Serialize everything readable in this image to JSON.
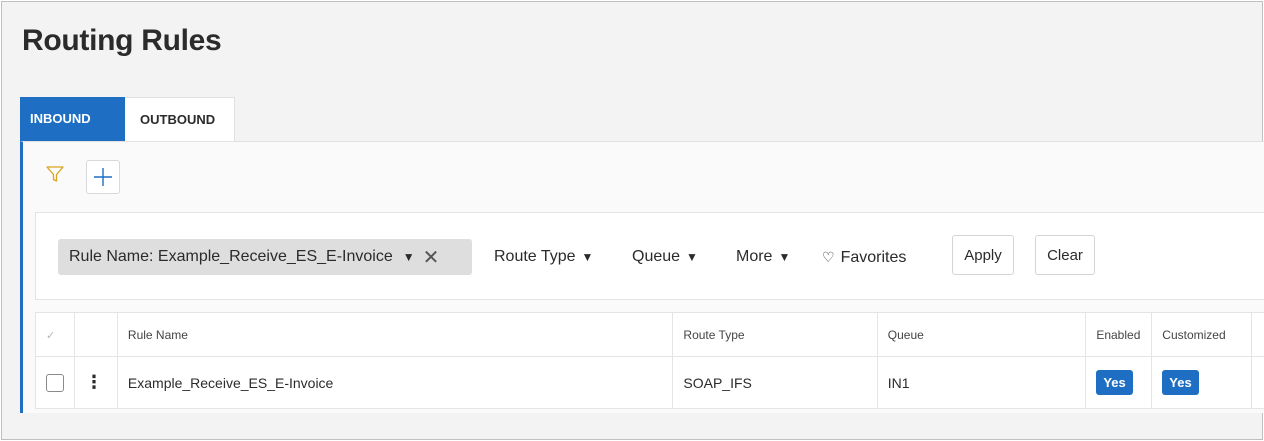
{
  "page": {
    "title": "Routing Rules"
  },
  "tabs": [
    {
      "label": "INBOUND",
      "active": true
    },
    {
      "label": "OUTBOUND",
      "active": false
    }
  ],
  "toolbar": {
    "filter_icon": "filter-icon",
    "add_icon": "plus-icon"
  },
  "filters": {
    "chip_label": "Rule Name: Example_Receive_ES_E-Invoice",
    "route_type": "Route Type",
    "queue": "Queue",
    "more": "More",
    "favorites": "Favorites",
    "apply": "Apply",
    "clear": "Clear"
  },
  "table": {
    "headers": [
      "Rule Name",
      "Route Type",
      "Queue",
      "Enabled",
      "Customized"
    ],
    "rows": [
      {
        "rule_name": "Example_Receive_ES_E-Invoice",
        "route_type": "SOAP_IFS",
        "queue": "IN1",
        "enabled": "Yes",
        "customized": "Yes"
      }
    ]
  },
  "colors": {
    "accent": "#1e6fc4",
    "filter_icon": "#d9a520"
  }
}
